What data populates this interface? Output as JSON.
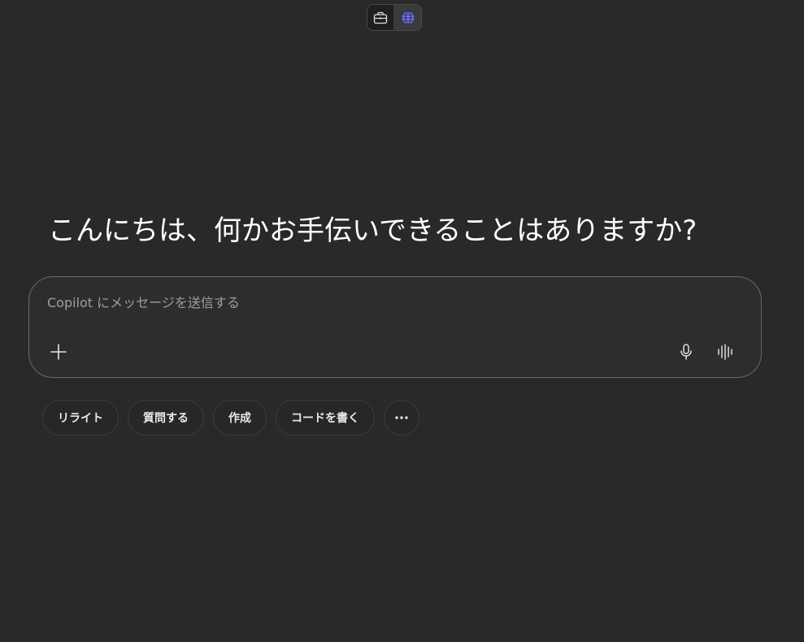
{
  "mode_toggle": {
    "work_icon": "briefcase-icon",
    "web_icon": "globe-icon",
    "active": "web"
  },
  "greeting": "こんにちは、何かお手伝いできることはありますか?",
  "composer": {
    "placeholder": "Copilot にメッセージを送信する",
    "value": "",
    "add_icon": "plus-icon",
    "mic_icon": "microphone-icon",
    "voice_icon": "voice-waveform-icon"
  },
  "suggestions": [
    {
      "label": "リライト"
    },
    {
      "label": "質問する"
    },
    {
      "label": "作成"
    },
    {
      "label": "コードを書く"
    }
  ],
  "more_icon": "more-horizontal-icon",
  "colors": {
    "background": "#292929",
    "composer_border": "#6a6a6a",
    "accent_globe": "#7f85f5"
  }
}
